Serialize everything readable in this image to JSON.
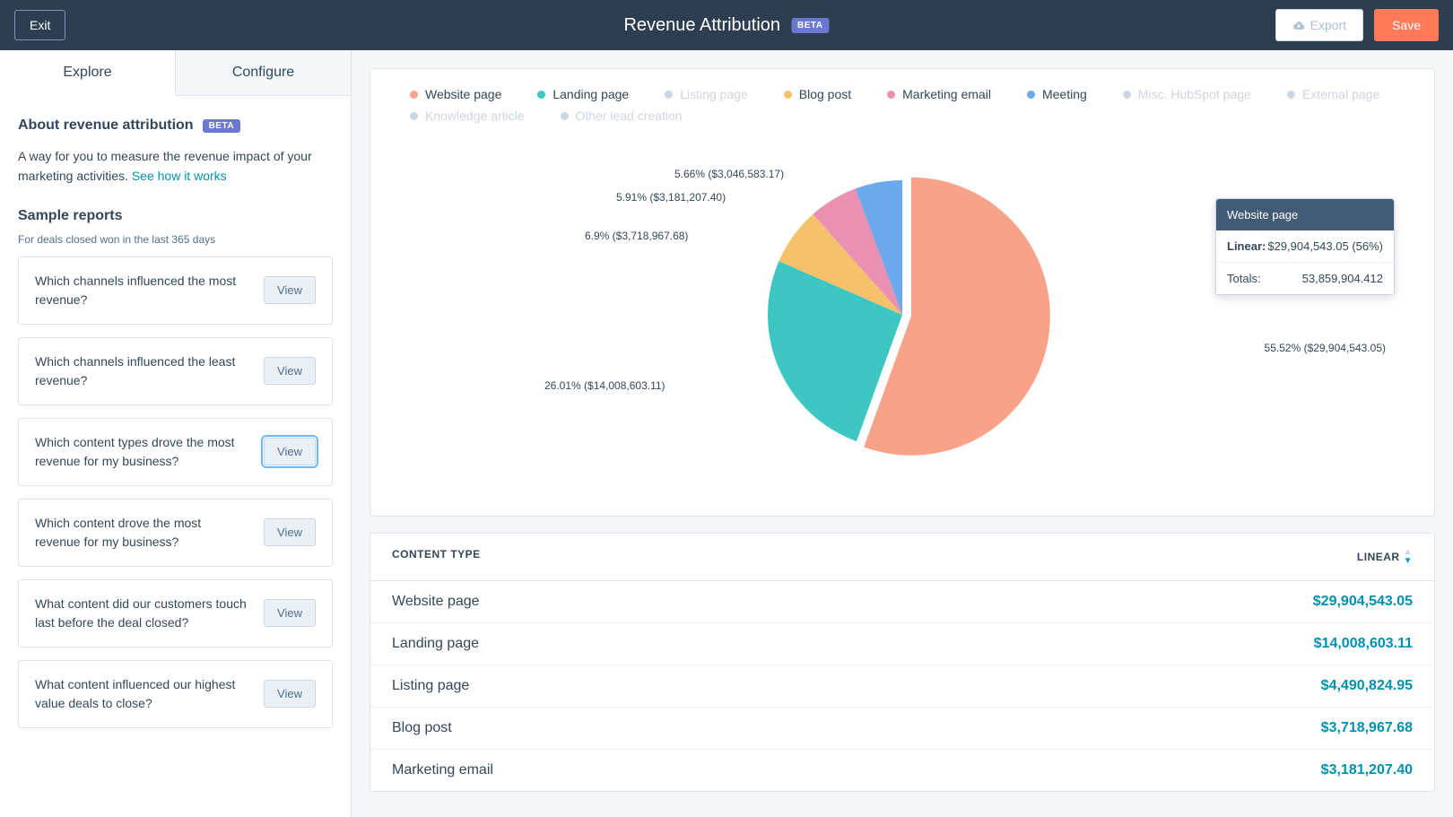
{
  "header": {
    "exit": "Exit",
    "title": "Revenue Attribution",
    "beta": "BETA",
    "export": "Export",
    "save": "Save"
  },
  "tabs": {
    "explore": "Explore",
    "configure": "Configure"
  },
  "about": {
    "heading": "About revenue attribution",
    "beta": "BETA",
    "desc": "A way for you to measure the revenue impact of your marketing activities. ",
    "link": "See how it works"
  },
  "sample": {
    "heading": "Sample reports",
    "sub": "For deals closed won in the last 365 days",
    "view": "View",
    "reports": [
      "Which channels influenced the most revenue?",
      "Which channels influenced the least revenue?",
      "Which content types drove the most revenue for my business?",
      "Which content drove the most revenue for my business?",
      "What content did our customers touch last before the deal closed?",
      "What content influenced our highest value deals to close?"
    ]
  },
  "legend": [
    {
      "label": "Website page",
      "color": "#f9a28a",
      "muted": false
    },
    {
      "label": "Landing page",
      "color": "#3ec7c2",
      "muted": false
    },
    {
      "label": "Listing page",
      "color": "#cbd6e2",
      "muted": true
    },
    {
      "label": "Blog post",
      "color": "#f5c26b",
      "muted": false
    },
    {
      "label": "Marketing email",
      "color": "#ea90b1",
      "muted": false
    },
    {
      "label": "Meeting",
      "color": "#6ba8ec",
      "muted": false
    },
    {
      "label": "Misc. HubSpot page",
      "color": "#cbd6e2",
      "muted": true
    },
    {
      "label": "External page",
      "color": "#cbd6e2",
      "muted": true
    },
    {
      "label": "Knowledge article",
      "color": "#cbd6e2",
      "muted": true
    },
    {
      "label": "Other lead creation",
      "color": "#cbd6e2",
      "muted": true
    }
  ],
  "chart_data": {
    "type": "pie",
    "title": "Revenue Attribution by Content Type",
    "series": [
      {
        "name": "Website page",
        "percent": 55.52,
        "value": 29904543.05,
        "label": "55.52% ($29,904,543.05)",
        "color": "#f9a28a"
      },
      {
        "name": "Landing page",
        "percent": 26.01,
        "value": 14008603.11,
        "label": "26.01% ($14,008,603.11)",
        "color": "#3ec7c2"
      },
      {
        "name": "Blog post",
        "percent": 6.9,
        "value": 3718967.68,
        "label": "6.9% ($3,718,967.68)",
        "color": "#f5c26b"
      },
      {
        "name": "Marketing email",
        "percent": 5.91,
        "value": 3181207.4,
        "label": "5.91% ($3,181,207.40)",
        "color": "#ea90b1"
      },
      {
        "name": "Meeting",
        "percent": 5.66,
        "value": 3046583.17,
        "label": "5.66% ($3,046,583.17)",
        "color": "#6ba8ec"
      }
    ],
    "total": 53859904.412
  },
  "tooltip": {
    "title": "Website page",
    "linear_label": "Linear:",
    "linear_value": "$29,904,543.05 (56%)",
    "totals_label": "Totals:",
    "totals_value": "53,859,904.412"
  },
  "table": {
    "col1": "CONTENT TYPE",
    "col2": "LINEAR",
    "rows": [
      {
        "type": "Website page",
        "value": "$29,904,543.05"
      },
      {
        "type": "Landing page",
        "value": "$14,008,603.11"
      },
      {
        "type": "Listing page",
        "value": "$4,490,824.95"
      },
      {
        "type": "Blog post",
        "value": "$3,718,967.68"
      },
      {
        "type": "Marketing email",
        "value": "$3,181,207.40"
      }
    ]
  }
}
